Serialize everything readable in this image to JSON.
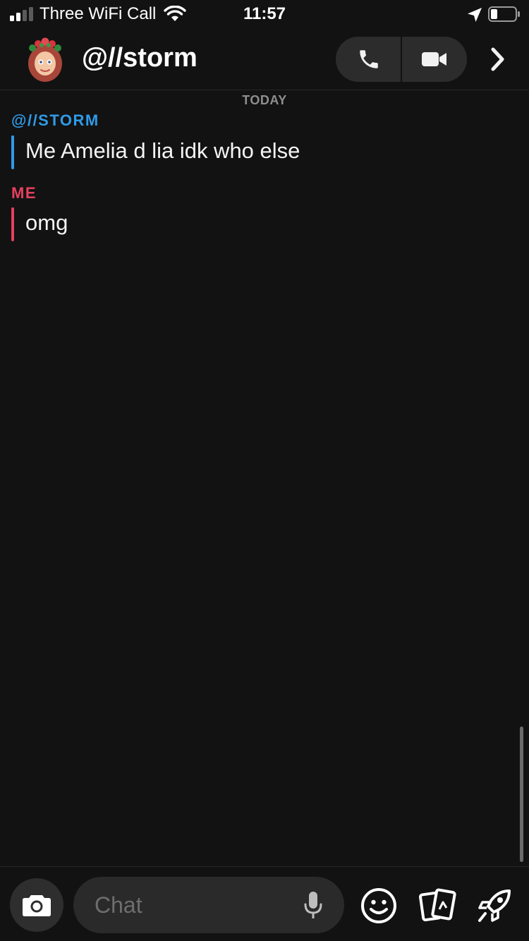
{
  "status_bar": {
    "carrier": "Three WiFi Call",
    "time": "11:57",
    "icons": [
      "signal-icon",
      "wifi-icon",
      "location-arrow-icon",
      "battery-icon"
    ]
  },
  "header": {
    "friend_name": "@//storm",
    "avatar_icon": "bitmoji-avatar",
    "actions": [
      "phone-icon",
      "video-camera-icon",
      "chevron-right-icon"
    ]
  },
  "conversation": {
    "date_label": "TODAY",
    "messages": [
      {
        "sender": "@//STORM",
        "text": "Me Amelia d lia idk who else",
        "color": "#2f9be8"
      },
      {
        "sender": "ME",
        "text": "omg",
        "color": "#e5405e"
      }
    ]
  },
  "composer": {
    "placeholder": "Chat",
    "value": "",
    "icons": [
      "camera-icon",
      "microphone-icon",
      "smiley-icon",
      "sticker-cards-icon",
      "rocket-icon"
    ]
  },
  "colors": {
    "background": "#121212",
    "friend_accent": "#2f9be8",
    "me_accent": "#e5405e",
    "pill_background": "#2c2c2c"
  }
}
